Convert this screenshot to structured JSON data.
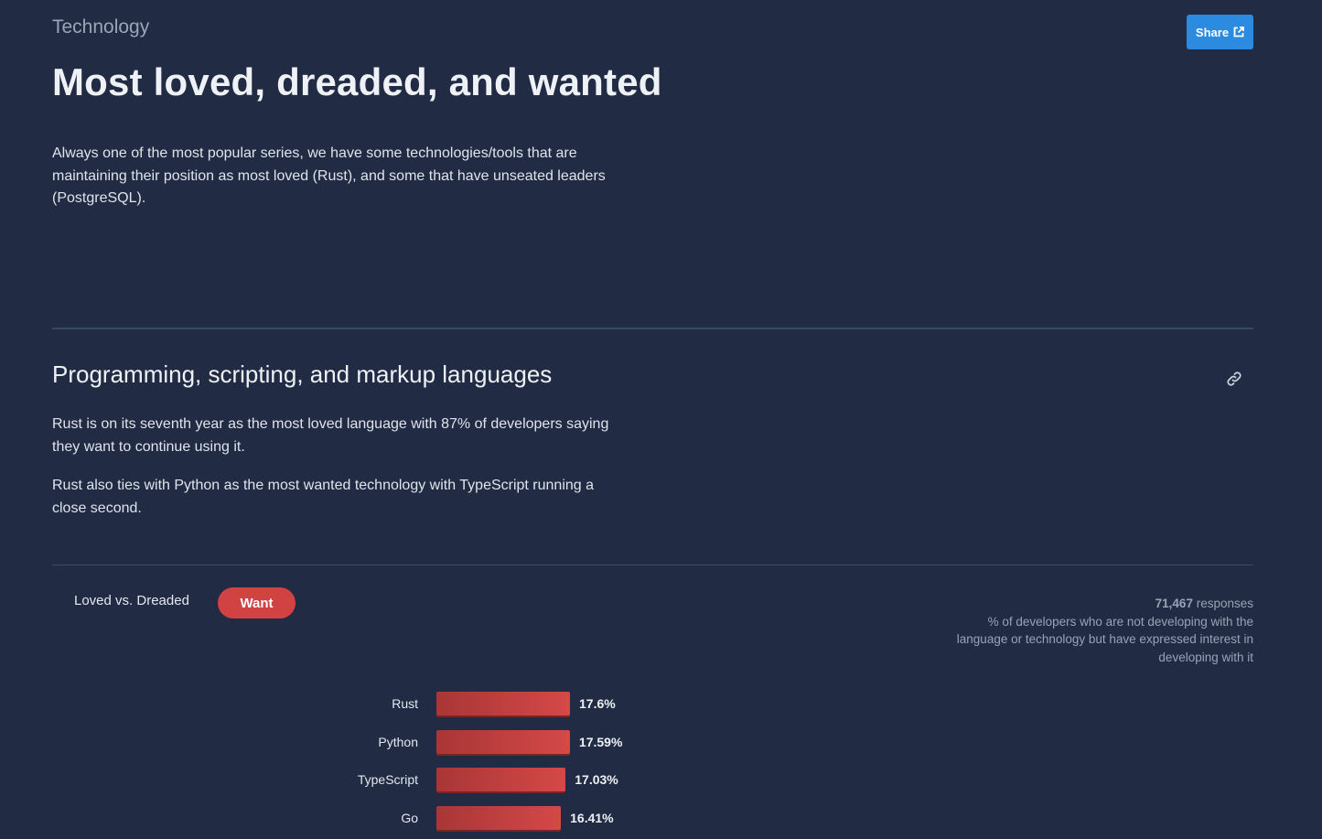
{
  "header": {
    "section": "Technology",
    "title": "Most loved, dreaded, and wanted",
    "share_label": "Share",
    "intro": "Always one of the most popular series, we have some technologies/tools that are maintaining their position as most loved (Rust), and some that have unseated leaders (PostgreSQL)."
  },
  "subsection": {
    "title": "Programming, scripting, and markup languages",
    "paragraphs": [
      "Rust is on its seventh year as the most loved language with 87% of developers saying they want to continue using it.",
      "Rust also ties with Python as the most wanted technology with TypeScript running a close second."
    ]
  },
  "tabs": {
    "loved": "Loved vs. Dreaded",
    "want": "Want",
    "active": "want"
  },
  "meta": {
    "responses_count": "71,467",
    "responses_label": " responses",
    "description": "% of developers who are not developing with the language or technology but have expressed interest in developing with it"
  },
  "colors": {
    "background": "#212b43",
    "accent_bar": "#d14242",
    "share_button": "#2a8be0"
  },
  "chart_data": {
    "type": "bar",
    "orientation": "horizontal",
    "categories": [
      "Rust",
      "Python",
      "TypeScript",
      "Go"
    ],
    "values": [
      17.6,
      17.59,
      17.03,
      16.41
    ],
    "value_labels": [
      "17.6%",
      "17.59%",
      "17.03%",
      "16.41%"
    ],
    "unit": "%"
  }
}
